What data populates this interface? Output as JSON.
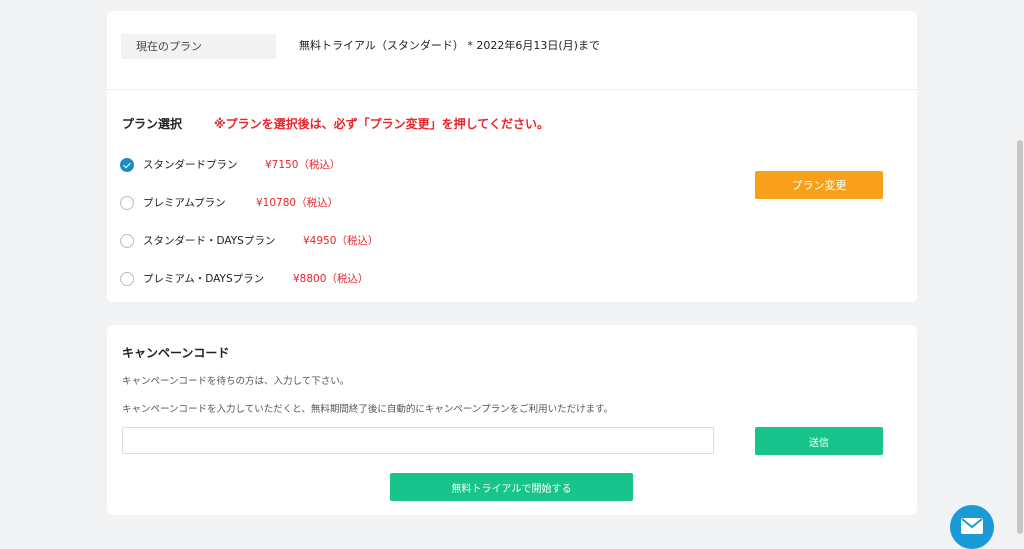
{
  "current_plan": {
    "label": "現在のプラン",
    "value": "無料トライアル（スタンダード） * 2022年6月13日(月)まで"
  },
  "plan_select": {
    "title": "プラン選択",
    "note": "※プランを選択後は、必ず「プラン変更」を押してください。",
    "options": [
      {
        "name": "スタンダードプラン",
        "price": "¥7150（税込）",
        "selected": true
      },
      {
        "name": "プレミアムプラン",
        "price": "¥10780（税込）",
        "selected": false
      },
      {
        "name": "スタンダード・DAYSプラン",
        "price": "¥4950（税込）",
        "selected": false
      },
      {
        "name": "プレミアム・DAYSプラン",
        "price": "¥8800（税込）",
        "selected": false
      }
    ],
    "change_button": "プラン変更"
  },
  "campaign": {
    "title": "キャンペーンコード",
    "desc1": "キャンペーンコードを待ちの方は、入力して下さい。",
    "desc2": "キャンペーンコードを入力していただくと、無料期間終了後に自動的にキャンペーンプランをご利用いただけます。",
    "input_value": "",
    "send_button": "送信",
    "trial_button": "無料トライアルで開始する"
  },
  "colors": {
    "accent_blue": "#1a8bc4",
    "orange": "#f8a01a",
    "green": "#18c48c",
    "red": "#e8262c"
  },
  "icons": {
    "chat": "mail-icon"
  }
}
